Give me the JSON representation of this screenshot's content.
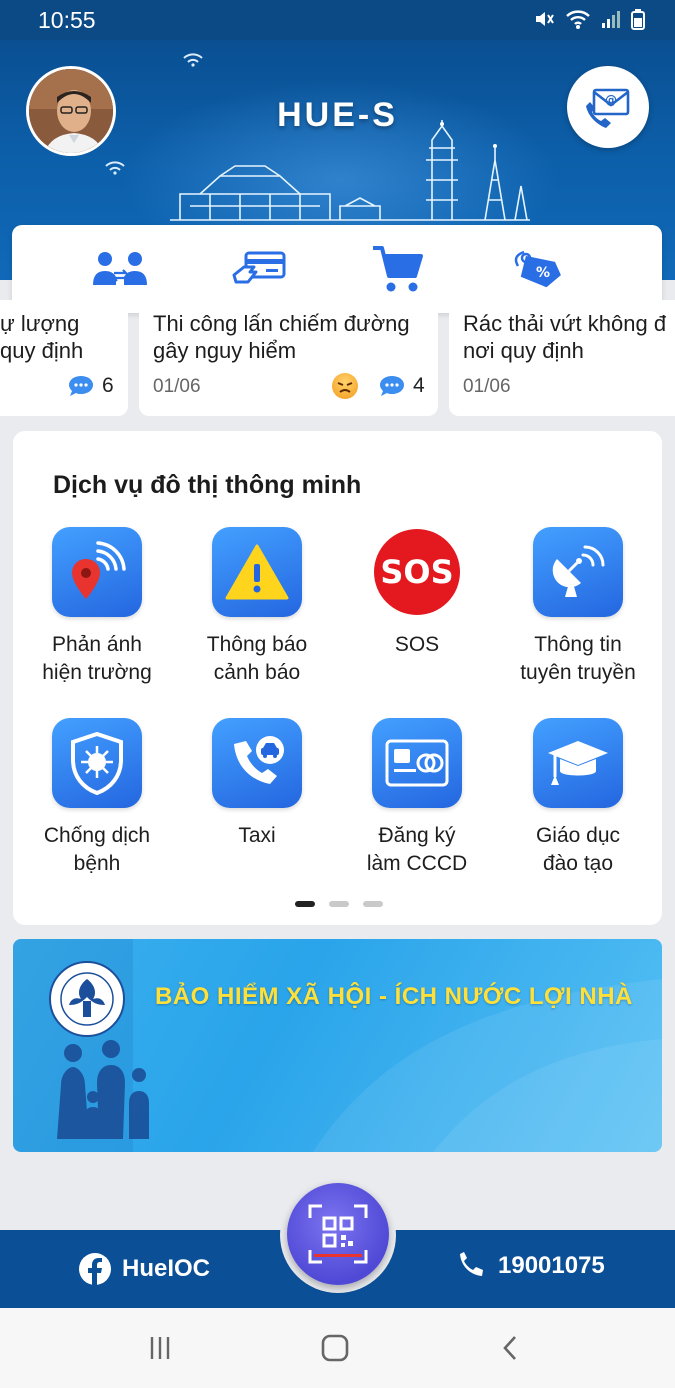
{
  "status_bar": {
    "time": "10:55"
  },
  "header": {
    "title": "HUE-S"
  },
  "quick_actions": [
    {
      "icon": "users-exchange-icon"
    },
    {
      "icon": "card-payment-icon"
    },
    {
      "icon": "shopping-cart-icon"
    },
    {
      "icon": "discount-tag-icon"
    }
  ],
  "news": [
    {
      "title_line1": "ự lượng",
      "title_line2": "quy định",
      "comments": "6"
    },
    {
      "title_line1": "Thi công lấn chiếm đường",
      "title_line2": "gây nguy hiểm",
      "date": "01/06",
      "comments": "4"
    },
    {
      "title_line1": "Rác thải vứt không đ",
      "title_line2": "nơi quy định",
      "date": "01/06"
    }
  ],
  "services": {
    "title": "Dịch vụ đô thị thông minh",
    "items": [
      {
        "line1": "Phản ánh",
        "line2": "hiện trường",
        "icon": "location-signal-icon"
      },
      {
        "line1": "Thông báo",
        "line2": "cảnh báo",
        "icon": "warning-icon"
      },
      {
        "line1": "SOS",
        "line2": "",
        "icon": "sos-icon"
      },
      {
        "line1": "Thông tin",
        "line2": "tuyên truyền",
        "icon": "satellite-dish-icon"
      },
      {
        "line1": "Chống dịch",
        "line2": "bệnh",
        "icon": "virus-shield-icon"
      },
      {
        "line1": "Taxi",
        "line2": "",
        "icon": "taxi-phone-icon"
      },
      {
        "line1": "Đăng ký",
        "line2": "làm CCCD",
        "icon": "id-card-icon"
      },
      {
        "line1": "Giáo dục",
        "line2": "đào tạo",
        "icon": "graduation-cap-icon"
      }
    ],
    "sos_text": "SOS",
    "page_count": 3,
    "active_page": 1
  },
  "banner": {
    "text": "BẢO HIỂM XÃ HỘI - ÍCH NƯỚC LỢI NHÀ"
  },
  "bottom_bar": {
    "facebook_label": "HueIOC",
    "phone_label": "19001075"
  },
  "colors": {
    "primary": "#0b4f97",
    "accent": "#2a6ee6",
    "banner_text": "#ffe03a",
    "sos": "#e3191f"
  }
}
